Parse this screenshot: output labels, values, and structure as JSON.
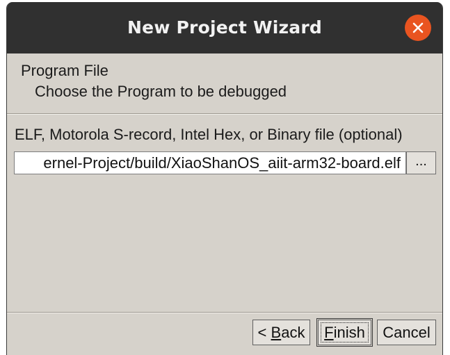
{
  "window": {
    "title": "New Project Wizard"
  },
  "header": {
    "title": "Program File",
    "subtitle": "Choose the Program to be debugged"
  },
  "program_file": {
    "label": "ELF, Motorola S-record, Intel Hex, or Binary file (optional)",
    "value": "ernel-Project/build/XiaoShanOS_aiit-arm32-board.elf",
    "browse_label": "..."
  },
  "buttons": {
    "back_prefix": "< ",
    "back_mnemonic": "B",
    "back_rest": "ack",
    "finish_mnemonic": "F",
    "finish_rest": "inish",
    "cancel": "Cancel"
  },
  "colors": {
    "titlebar": "#303030",
    "dialog_bg": "#d6d2cb",
    "close_button": "#e95420"
  },
  "icons": {
    "close": "close-icon"
  }
}
